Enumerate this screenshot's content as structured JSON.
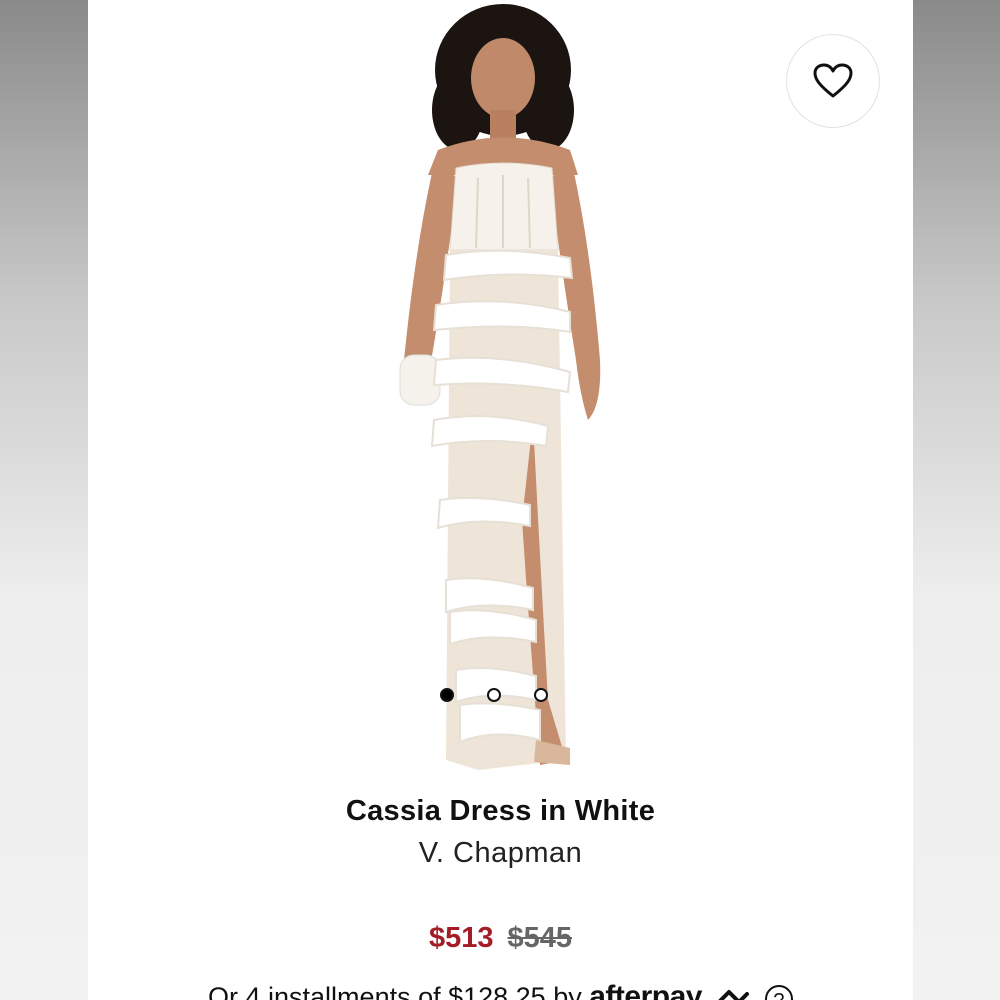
{
  "product": {
    "title": "Cassia Dress in White",
    "brand": "V. Chapman",
    "sale_price": "$513",
    "original_price": "$545",
    "installments_text": "Or 4 installments of $128.25 by",
    "installments_provider": "afterpay",
    "info_glyph": "?"
  },
  "gallery": {
    "image_count": 3,
    "active_index": 0
  },
  "icons": {
    "wishlist": "heart-icon",
    "info": "info-icon",
    "afterpay_logo": "afterpay-loop-icon"
  },
  "colors": {
    "sale_price": "#a31c26",
    "original_price": "#666666",
    "text": "#111111"
  }
}
